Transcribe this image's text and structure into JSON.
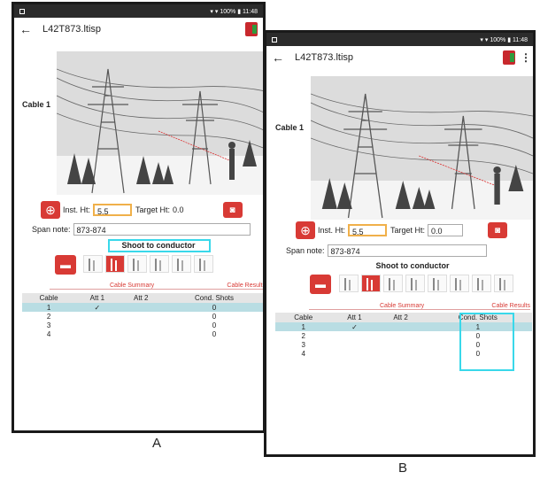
{
  "status": {
    "battery": "100%",
    "time": "11:48"
  },
  "app": {
    "title": "L42T873.ltisp"
  },
  "cable_label": "Cable 1",
  "inst_label": "Inst. Ht:",
  "inst_value": "5.5",
  "target_label": "Target Ht:",
  "target_value": "0.0",
  "span_label": "Span note:",
  "span_value": "873-874",
  "shoot_label": "Shoot to conductor",
  "tabs": {
    "summary": "Cable Summary",
    "results": "Cable Results"
  },
  "table": {
    "headers": [
      "Cable",
      "Att 1",
      "Att 2",
      "Cond. Shots"
    ],
    "rows": [
      {
        "cable": "1",
        "att1": "✓",
        "att2": "",
        "shots": "0"
      },
      {
        "cable": "2",
        "att1": "",
        "att2": "",
        "shots": "0"
      },
      {
        "cable": "3",
        "att1": "",
        "att2": "",
        "shots": "0"
      },
      {
        "cable": "4",
        "att1": "",
        "att2": "",
        "shots": "0"
      }
    ],
    "shots_b": [
      "1",
      "0",
      "0",
      "0"
    ]
  },
  "captions": {
    "a": "A",
    "b": "B"
  },
  "icons": [
    "back-arrow-icon",
    "app-icon",
    "target-icon",
    "camera-icon",
    "trash-icon",
    "kebab-menu-icon"
  ],
  "colors": {
    "accent": "#d83a35",
    "highlight": "#39d8ea",
    "selected_row": "#b9dde3"
  }
}
